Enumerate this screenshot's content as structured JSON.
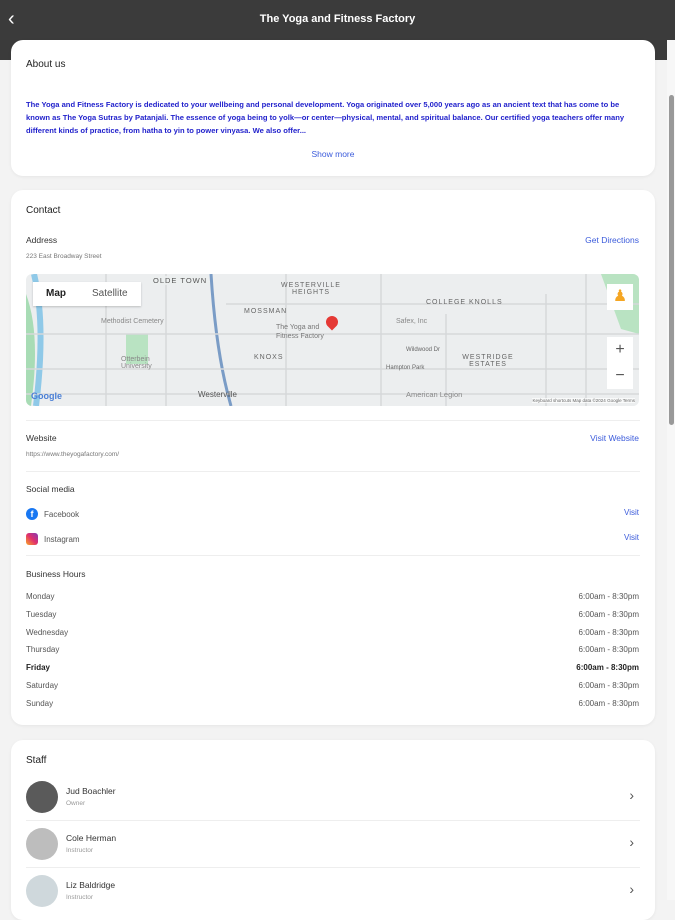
{
  "header": {
    "title": "The Yoga and Fitness Factory",
    "back": "‹"
  },
  "about": {
    "heading": "About us",
    "text": "The Yoga and Fitness Factory is dedicated to your wellbeing and personal development. Yoga originated over 5,000 years ago as an ancient text that has come to be known as The Yoga Sutras by Patanjali. The essence of yoga being to yolk—or center—physical, mental, and spiritual balance. Our certified yoga teachers offer many different kinds of practice, from hatha to yin to power vinyasa. We also offer...",
    "show_more": "Show more"
  },
  "contact": {
    "heading": "Contact",
    "address_label": "Address",
    "address": "223 East Broadway Street",
    "directions": "Get Directions",
    "map": {
      "tab_map": "Map",
      "tab_satellite": "Satellite",
      "zoom_in": "+",
      "zoom_out": "−",
      "labels": [
        "OLDE TOWN",
        "WESTERVILLE HEIGHTS",
        "MOSSMAN",
        "Methodist Cemetery",
        "The Yoga and Fitness Factory",
        "Safex, Inc",
        "COLLEGE KNOLLS",
        "KNOXS",
        "WESTRIDGE ESTATES",
        "Otterbein University",
        "Westerville",
        "American Legion",
        "Wildwood Dr",
        "Hampton Park"
      ],
      "google": "Google",
      "footer": "Keyboard shortcuts   Map data ©2024 Google   Terms"
    },
    "website_label": "Website",
    "website_url": "https://www.theyogafactory.com/",
    "visit_website": "Visit Website",
    "social_label": "Social media",
    "social": [
      {
        "name": "Facebook",
        "link": "Visit"
      },
      {
        "name": "Instagram",
        "link": "Visit"
      }
    ],
    "hours_label": "Business Hours",
    "hours": [
      {
        "day": "Monday",
        "time": "6:00am - 8:30pm"
      },
      {
        "day": "Tuesday",
        "time": "6:00am - 8:30pm"
      },
      {
        "day": "Wednesday",
        "time": "6:00am - 8:30pm"
      },
      {
        "day": "Thursday",
        "time": "6:00am - 8:30pm"
      },
      {
        "day": "Friday",
        "time": "6:00am - 8:30pm"
      },
      {
        "day": "Saturday",
        "time": "6:00am - 8:30pm"
      },
      {
        "day": "Sunday",
        "time": "6:00am - 8:30pm"
      }
    ]
  },
  "staff": {
    "heading": "Staff",
    "members": [
      {
        "name": "Jud Boachler",
        "role": "Owner"
      },
      {
        "name": "Cole Herman",
        "role": "Instructor"
      },
      {
        "name": "Liz Baldridge",
        "role": "Instructor"
      }
    ]
  },
  "colors": {
    "accent": "#3b5bdb",
    "header": "#3b3b3b",
    "about_text": "#2222cc"
  }
}
